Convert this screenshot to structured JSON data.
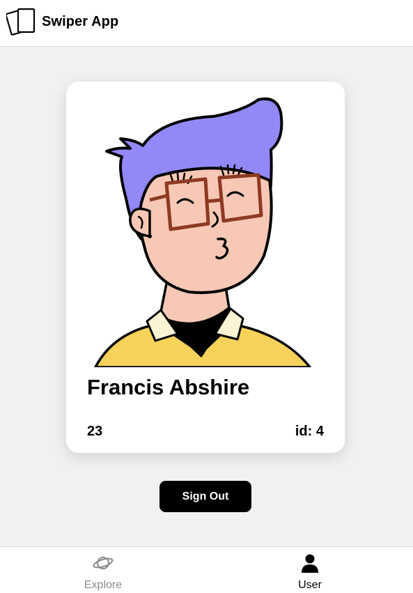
{
  "header": {
    "title": "Swiper App",
    "logo_icon": "cards-icon"
  },
  "profile": {
    "name": "Francis Abshire",
    "age": "23",
    "id_label": "id: 4",
    "avatar": "cartoon-avatar-glasses-purple-hair"
  },
  "actions": {
    "sign_out_label": "Sign Out"
  },
  "tabbar": {
    "tabs": [
      {
        "label": "Explore",
        "icon": "planet-icon",
        "active": false
      },
      {
        "label": "User",
        "icon": "user-icon",
        "active": true
      }
    ]
  },
  "colors": {
    "background": "#f1f1f1",
    "card": "#ffffff",
    "hair": "#9388f8",
    "skin": "#f7c8b5",
    "shirt": "#f6d25a",
    "glasses": "#8e3a22",
    "button": "#000000",
    "inactive_tab": "#8a8a8a"
  }
}
